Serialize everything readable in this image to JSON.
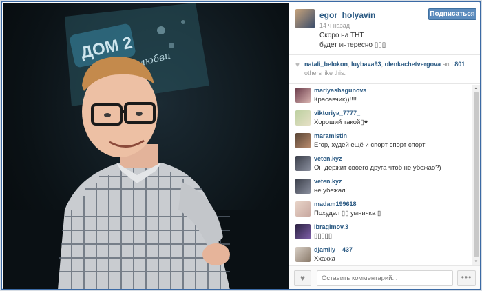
{
  "post": {
    "username": "egor_holyavin",
    "follow_label": "Подписаться",
    "time": "14 ч назад",
    "caption_line1": "Скоро на ТНТ",
    "caption_line2": "будет интересно ▯▯▯"
  },
  "photo": {
    "sign_text": "ДОМ 2",
    "sign_script": "Город любви"
  },
  "likes": {
    "user1": "natali_belokon",
    "user2": "luybava93",
    "user3": "olenkachetvergova",
    "and_label": "and",
    "count": "801",
    "suffix": "others like this."
  },
  "comments": [
    {
      "user": "mariyashagunova",
      "text": "Красавчик))!!!!"
    },
    {
      "user": "viktoriya_7777_",
      "text": "Хороший такой▯♥"
    },
    {
      "user": "maramistin",
      "text": "Егор, худей ещё и спорт спорт спорт"
    },
    {
      "user": "veten.kyz",
      "text": "Он держит своего друга чтоб не убежао?)"
    },
    {
      "user": "veten.kyz",
      "text": "не убежал'"
    },
    {
      "user": "madam199618",
      "text": "Похудел ▯▯ умничка ▯"
    },
    {
      "user": "ibragimov.3",
      "text": "▯▯▯▯▯"
    },
    {
      "user": "djamily__437",
      "text": "Ххахха"
    }
  ],
  "footer": {
    "comment_placeholder": "Оставить комментарий...",
    "more_label": "•••"
  },
  "colors": {
    "link": "#2b5a83",
    "follow_button": "#5b8bbd",
    "frame": "#3b6aa5"
  }
}
